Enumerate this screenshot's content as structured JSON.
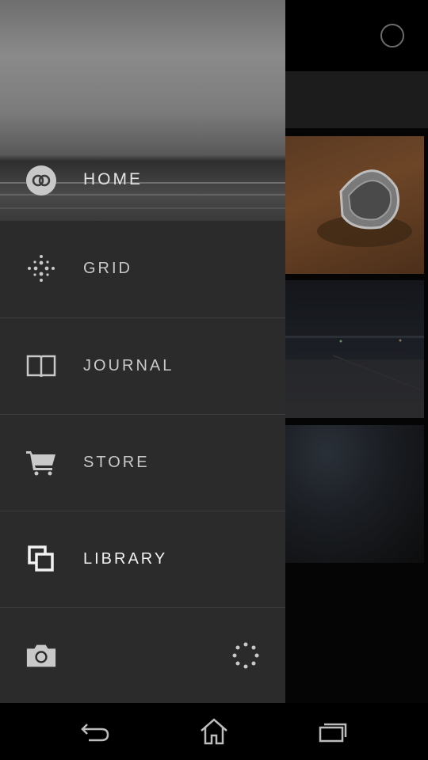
{
  "drawer": {
    "home_label": "HOME",
    "items": [
      {
        "label": "GRID",
        "icon": "grid-dots-icon",
        "active": false
      },
      {
        "label": "JOURNAL",
        "icon": "book-icon",
        "active": false
      },
      {
        "label": "STORE",
        "icon": "cart-icon",
        "active": false
      },
      {
        "label": "LIBRARY",
        "icon": "library-icon",
        "active": true
      }
    ],
    "bottom": {
      "left_icon": "camera-icon",
      "right_icon": "loading-dots-icon"
    }
  },
  "navbar": {
    "icons": [
      "back-icon",
      "home-icon",
      "recent-apps-icon"
    ]
  },
  "colors": {
    "drawer_bg": "#2b2b2b",
    "active_text": "#f2f2f2",
    "inactive_text": "#c9c9c9"
  }
}
